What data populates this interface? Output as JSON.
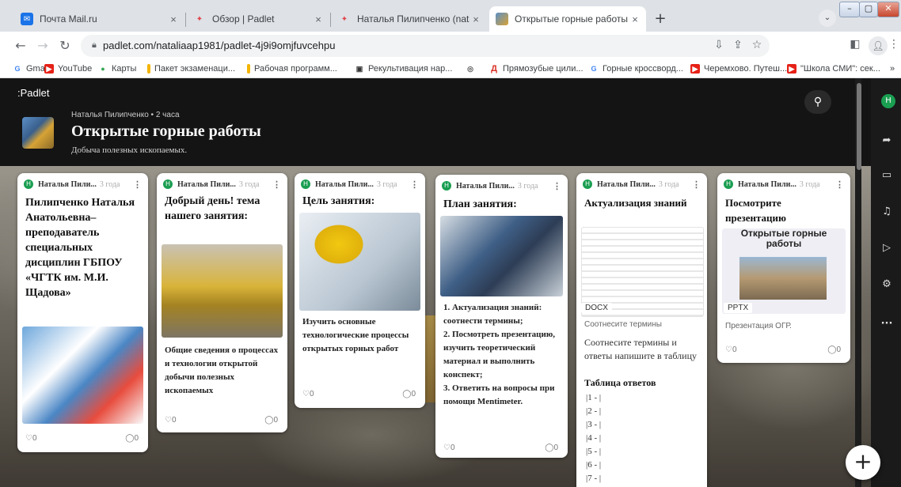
{
  "browser": {
    "tabs": [
      {
        "label": "Почта Mail.ru",
        "close": "×"
      },
      {
        "label": "Обзор | Padlet",
        "close": "×"
      },
      {
        "label": "Наталья Пилипченко (nataliaap",
        "close": "×"
      },
      {
        "label": "Открытые горные работы",
        "close": "×"
      }
    ],
    "new_tab": "+",
    "url": "padlet.com/nataliaap1981/padlet-4j9i9omjfuvcehpu",
    "bookmarks": [
      {
        "label": "Gmail",
        "icon": "G"
      },
      {
        "label": "YouTube",
        "icon": "▶"
      },
      {
        "label": "Карты",
        "icon": "●"
      },
      {
        "label": "Пакет экзаменаци...",
        "icon": ""
      },
      {
        "label": "Рабочая программ...",
        "icon": ""
      },
      {
        "label": "Рекультивация нар...",
        "icon": "▣"
      },
      {
        "label": "",
        "icon": "◎"
      },
      {
        "label": "Прямозубые цили...",
        "icon": "Д"
      },
      {
        "label": "Горные кроссворд...",
        "icon": "G"
      },
      {
        "label": "Черемхово. Путеш...",
        "icon": "▶"
      },
      {
        "label": "\"Школа СМИ\": сек...",
        "icon": "▶"
      }
    ],
    "bookmarks_more": "»"
  },
  "padlet": {
    "logo": ":Padlet",
    "board": {
      "meta": "Наталья Пилипченко • 2 часа",
      "title": "Открытые горные работы",
      "subtitle": "Добыча полезных ископаемых."
    },
    "rail_avatar": "Н",
    "posts": [
      {
        "author": "Наталья Пили...",
        "time": "3 года",
        "avatar": "Н",
        "title": "Пилипченко Наталья Анатольевна–преподаватель специальных дисциплин ГБПОУ «ЧГТК им. М.И. Щадова»",
        "likes": "0",
        "comments": "0"
      },
      {
        "author": "Наталья Пили...",
        "time": "3 года",
        "avatar": "Н",
        "title": "Добрый день! тема нашего занятия:",
        "body": "Общие сведения о процессах и технологии открытой добычи полезных ископаемых",
        "likes": "0",
        "comments": "0"
      },
      {
        "author": "Наталья Пили...",
        "time": "3 года",
        "avatar": "Н",
        "title": "Цель занятия:",
        "body": "Изучить основные технологические процессы открытых горных работ",
        "likes": "0",
        "comments": "0"
      },
      {
        "author": "Наталья Пили...",
        "time": "3 года",
        "avatar": "Н",
        "title": "План занятия:",
        "body": "1. Актуализация знаний: соотнести термины;\n2. Посмотреть презентацию, изучить теоретический материал и выполнить конспект;\n3. Ответить на вопросы при помощи Mentimeter.",
        "likes": "0",
        "comments": "0"
      },
      {
        "author": "Наталья Пили...",
        "time": "3 года",
        "avatar": "Н",
        "title": "Актуализация знаний",
        "file_type": "DOCX",
        "caption": "Соотнесите термины",
        "text": "Соотнесите термины и ответы напишите в таблицу",
        "answers_title": "Таблица ответов",
        "answers": [
          "|1 - |",
          "|2 - |",
          "|3 - |",
          "|4 - |",
          "|5 - |",
          "|6 - |",
          "|7 - |"
        ]
      },
      {
        "author": "Наталья Пили...",
        "time": "3 года",
        "avatar": "Н",
        "title": "Посмотрите презентацию",
        "slide_title": "Открытые горные работы",
        "file_type": "PPTX",
        "caption": "Презентация ОГР.",
        "likes": "0",
        "comments": "0"
      }
    ],
    "fab": "+"
  }
}
